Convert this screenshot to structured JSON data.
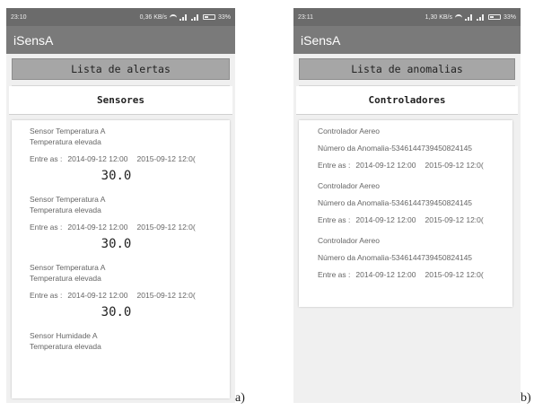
{
  "screens": [
    {
      "status": {
        "time": "23:10",
        "speed": "0,36 KB/s",
        "battery": "33%"
      },
      "app_title": "iSensA",
      "button_label": "Lista de alertas",
      "section_label": "Sensores",
      "alerts": [
        {
          "title": "Sensor Temperatura A",
          "description": "Temperatura elevada",
          "range_label": "Entre as :",
          "start": "2014-09-12 12:00",
          "end": "2015-09-12 12:0(",
          "value": "30.0"
        },
        {
          "title": "Sensor Temperatura A",
          "description": "Temperatura elevada",
          "range_label": "Entre as :",
          "start": "2014-09-12 12:00",
          "end": "2015-09-12 12:0(",
          "value": "30.0"
        },
        {
          "title": "Sensor Temperatura A",
          "description": "Temperatura elevada",
          "range_label": "Entre as :",
          "start": "2014-09-12 12:00",
          "end": "2015-09-12 12:0(",
          "value": "30.0"
        },
        {
          "title": "Sensor Humidade A",
          "description": "Temperatura elevada"
        }
      ],
      "caption": "a)"
    },
    {
      "status": {
        "time": "23:11",
        "speed": "1,30 KB/s",
        "battery": "33%"
      },
      "app_title": "iSensA",
      "button_label": "Lista de anomalias",
      "section_label": "Controladores",
      "anomalies": [
        {
          "title": "Controlador Aereo",
          "number": "Número da Anomalia-5346144739450824145",
          "range_label": "Entre as :",
          "start": "2014-09-12 12:00",
          "end": "2015-09-12 12:0("
        },
        {
          "title": "Controlador Aereo",
          "number": "Número da Anomalia-5346144739450824145",
          "range_label": "Entre as :",
          "start": "2014-09-12 12:00",
          "end": "2015-09-12 12:0("
        },
        {
          "title": "Controlador Aereo",
          "number": "Número da Anomalia-5346144739450824145",
          "range_label": "Entre as :",
          "start": "2014-09-12 12:00",
          "end": "2015-09-12 12:0("
        }
      ],
      "caption": "b)"
    }
  ]
}
